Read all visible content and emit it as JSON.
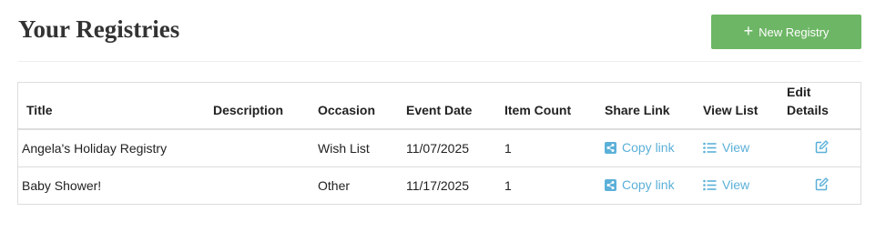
{
  "header": {
    "title": "Your Registries",
    "new_button_label": "New Registry",
    "new_button_icon": "plus-icon"
  },
  "colors": {
    "accent_green": "#6db665",
    "link_blue": "#5bb0d8",
    "border": "#dddddd"
  },
  "table": {
    "columns": {
      "title": "Title",
      "description": "Description",
      "occasion": "Occasion",
      "event_date": "Event Date",
      "item_count": "Item Count",
      "share_link": "Share Link",
      "view_list": "View List",
      "edit_details_line1": "Edit",
      "edit_details_line2": "Details"
    },
    "rows": [
      {
        "title": "Angela's Holiday Registry",
        "description": "",
        "occasion": "Wish List",
        "event_date": "11/07/2025",
        "item_count": "1",
        "share_label": "Copy link",
        "view_label": "View"
      },
      {
        "title": "Baby Shower!",
        "description": "",
        "occasion": "Other",
        "event_date": "11/17/2025",
        "item_count": "1",
        "share_label": "Copy link",
        "view_label": "View"
      }
    ],
    "icons": {
      "share": "share-icon",
      "view": "list-icon",
      "edit": "edit-icon"
    }
  }
}
